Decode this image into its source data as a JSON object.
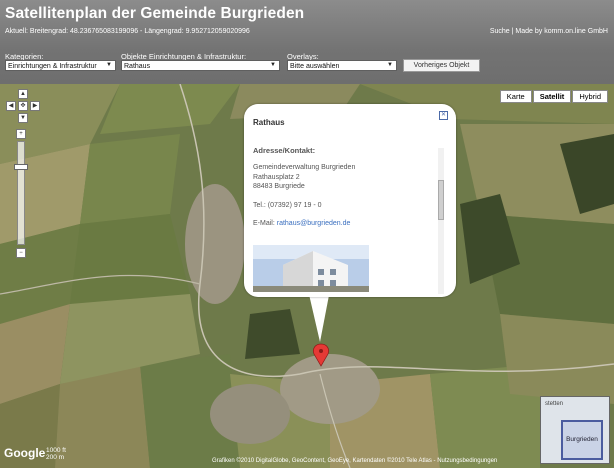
{
  "header": {
    "title": "Satellitenplan der Gemeinde Burgrieden",
    "coords": "Aktuell: Breitengrad: 48.236765083199096 - Längengrad: 9.952712059020996",
    "links": "Suche | Made by komm.on.line GmbH"
  },
  "filters": {
    "kategorien_label": "Kategorien:",
    "kategorien_value": "Einrichtungen & Infrastruktur",
    "objekte_label": "Objekte Einrichtungen & Infrastruktur:",
    "objekte_value": "Rathaus",
    "overlays_label": "Overlays:",
    "overlays_value": "Bitte auswählen",
    "prev_button": "Vorheriges Objekt"
  },
  "maptypes": [
    "Karte",
    "Satellit",
    "Hybrid"
  ],
  "popup": {
    "title": "Rathaus",
    "section": "Adresse/Kontakt:",
    "org": "Gemeindeverwaltung Burgrieden",
    "street": "Rathausplatz 2",
    "city": "88483 Burgriede",
    "phone": "Tel.: (07392) 97 19 - 0",
    "email_label": "E-Mail:",
    "email": "rathaus@burgrieden.de"
  },
  "minimap": {
    "label": "Burgrieden",
    "label_top": "stetten"
  },
  "scale": {
    "top": "1000 ft",
    "bottom": "200 m"
  },
  "logo": "Google",
  "copyright": "Grafiken ©2010 DigitalGlobe, GeoContent, GeoEye, Kartendaten ©2010 Tele Atlas - Nutzungsbedingungen",
  "colors": {
    "header": "#7a7a7a",
    "popup_link": "#3a6fbf",
    "marker": "#e53935"
  }
}
